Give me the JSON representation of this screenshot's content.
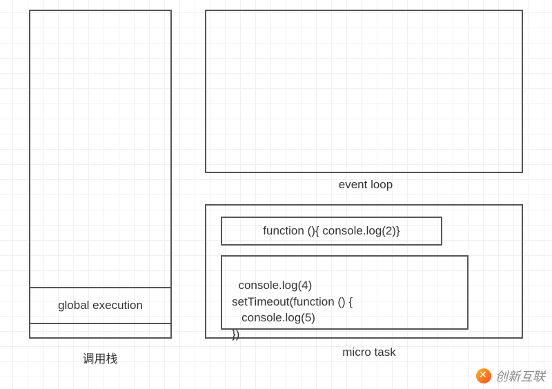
{
  "callstack": {
    "frame_label": "global execution",
    "caption": "调用栈"
  },
  "eventloop": {
    "caption": "event loop"
  },
  "microtask": {
    "caption": "micro task",
    "items": [
      "function (){ console.log(2)}",
      "console.log(4)\nsetTimeout(function () {\n   console.log(5)\n})"
    ]
  },
  "watermark": {
    "text": "创新互联"
  }
}
